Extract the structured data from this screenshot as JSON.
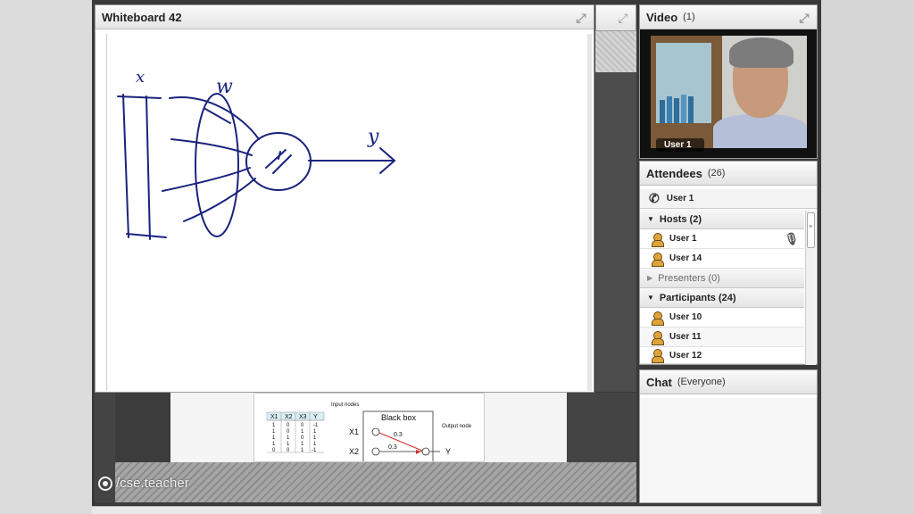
{
  "whiteboard": {
    "title": "Whiteboard 42"
  },
  "drawing": {
    "labels": {
      "x": "x",
      "w": "w",
      "y": "y"
    }
  },
  "slide": {
    "black_box_title": "Black box",
    "input_nodes_label": "Input nodes",
    "output_node_label": "Output node",
    "inputs": [
      "X1",
      "X2"
    ],
    "weights": [
      "0.3",
      "0.3"
    ],
    "output": "Y",
    "table": {
      "headers": [
        "X1",
        "X2",
        "X3",
        "Y"
      ],
      "rows": [
        [
          "1",
          "0",
          "0",
          "-1"
        ],
        [
          "1",
          "0",
          "1",
          "1"
        ],
        [
          "1",
          "1",
          "0",
          "1"
        ],
        [
          "1",
          "1",
          "1",
          "1"
        ],
        [
          "0",
          "0",
          "1",
          "-1"
        ]
      ]
    }
  },
  "watermark": {
    "text": "/cse.teacher"
  },
  "video": {
    "title": "Video",
    "count": "(1)",
    "user_label": "User 1"
  },
  "attendees": {
    "title": "Attendees",
    "count": "(26)",
    "caller": "User 1",
    "hosts": {
      "label": "Hosts (2)",
      "users": [
        "User 1",
        "User 14"
      ]
    },
    "presenters": {
      "label": "Presenters (0)"
    },
    "participants": {
      "label": "Participants (24)",
      "users": [
        "User 10",
        "User 11",
        "User 12"
      ]
    }
  },
  "chat": {
    "title": "Chat",
    "scope": "(Everyone)"
  },
  "icons": {
    "maximize": "maximize-icon",
    "phone": "phone-icon",
    "user": "user-icon",
    "microphone": "microphone-icon",
    "logo": "logo-icon"
  },
  "colors": {
    "user_icon": "#e0a33a",
    "highlight_node": "#d32f2f"
  }
}
